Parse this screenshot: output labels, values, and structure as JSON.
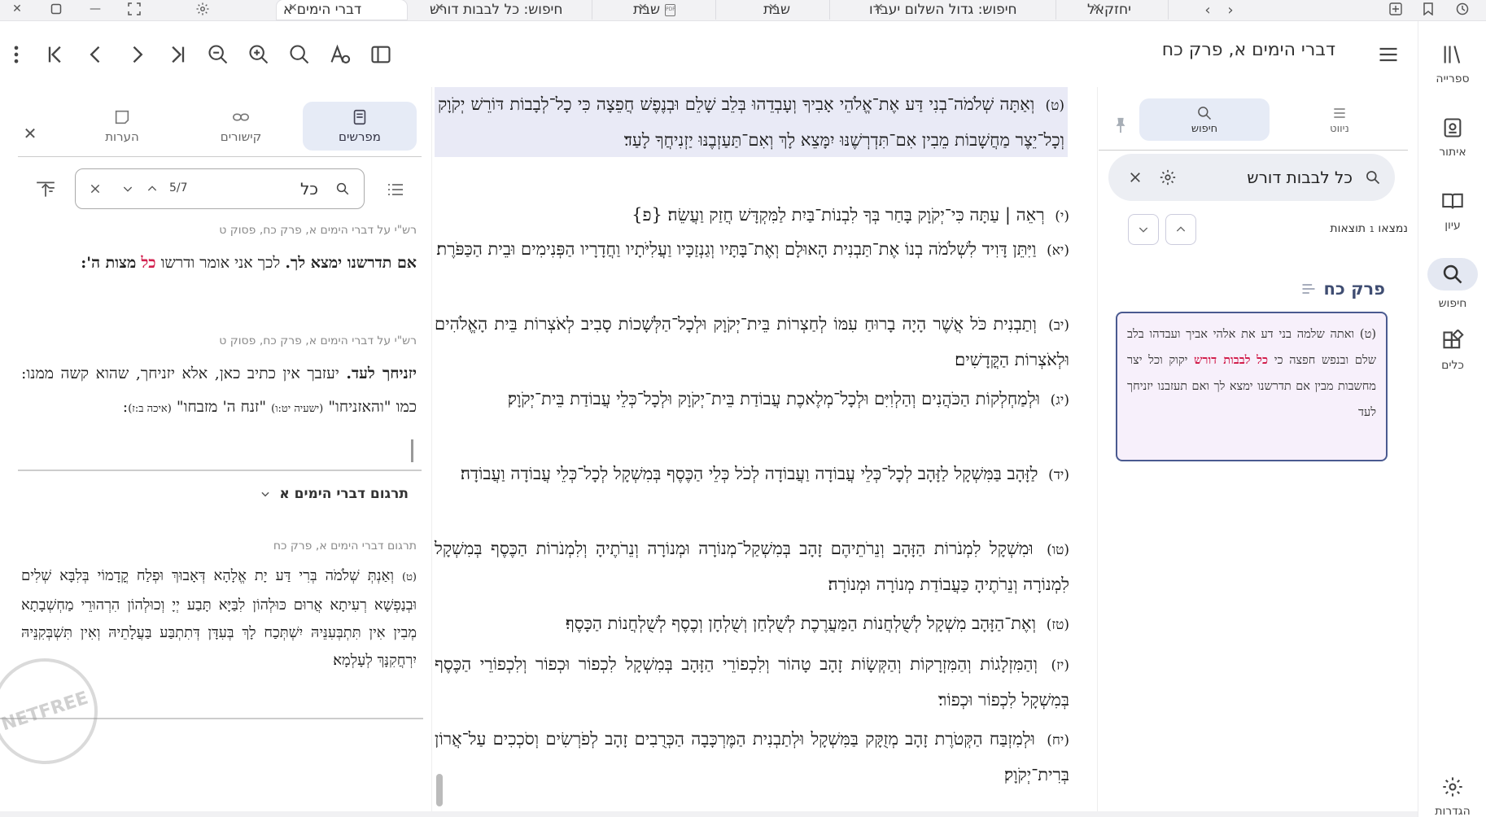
{
  "tabs": [
    {
      "label": "דברי הימים א",
      "active": true
    },
    {
      "label": "חיפוש: כל לבבות דורש",
      "active": false
    },
    {
      "label": "שבת",
      "active": false,
      "icon": "pdf-icon"
    },
    {
      "label": "שבת",
      "active": false
    },
    {
      "label": "חיפוש: גדול השלום יעבדו",
      "active": false
    },
    {
      "label": "יחזקאל",
      "active": false
    }
  ],
  "toolbar": {
    "title": "דברי הימים א, פרק כח"
  },
  "rail": [
    {
      "label": "ספרייה",
      "icon": "library-icon"
    },
    {
      "label": "איתור",
      "icon": "locate-icon"
    },
    {
      "label": "עיון",
      "icon": "book-icon"
    },
    {
      "label": "חיפוש",
      "icon": "search-icon",
      "active": true
    },
    {
      "label": "כלים",
      "icon": "tools-icon"
    },
    {
      "label": "הגדרות",
      "icon": "gear-icon"
    }
  ],
  "search_panel": {
    "tabs": {
      "nav": "ניווט",
      "search": "חיפוש"
    },
    "query": "כל לבבות דורש",
    "count_prefix": "נמצאו",
    "count_num": "1",
    "count_suffix": "תוצאות",
    "chapter": "פרק כח",
    "result": {
      "before": "(ט) ואתה שלמה בני דע את אלהי אביך ועבדהו בלב שלם ובנפש חפצה כי",
      "hl1": "כל",
      "hl2": "לבבות דורש",
      "after": "יקוק וכל יצר מחשבות מבין אם תדרשנו ימצא לך ואם תעזבנו יזניחך לעד"
    }
  },
  "main": {
    "verses": [
      {
        "num": "(ט)",
        "text": "וְאַתָּה שְׁלֹמֹה־בְנִי דַּע אֶת־אֱלֹהֵי אָבִיךָ וְעָבְדֵהוּ בְּלֵב שָׁלֵם וּבְנֶפֶשׁ חֲפֵצָה כִּי כָל־לְבָבוֹת דּוֹרֵשׁ יְקֹוָק וְכָל־יֵצֶר מַחֲשָׁבוֹת מֵבִין אִם־תִּדְרְשֶׁנּוּ יִמָּצֵא לָךְ וְאִם־תַּעַזְבֶנּוּ יַזְנִיחֲךָ לָעַד׃"
      },
      {
        "num": "(י)",
        "text": "רְאֵה | עַתָּה כִּי־יְקֹוָק בָּחַר בְּךָ לִבְנוֹת־בַּיִת לַמִּקְדָּשׁ חֲזַק וַעֲשֵׂה׃ {פ}"
      },
      {
        "num": "(יא)",
        "text": "וַיִּתֵּן דָּוִיד לִשְׁלֹמֹה בְנוֹ אֶת־תַּבְנִית הָאוּלָם וְאֶת־בָּתָּיו וְגַנְזַכָּיו וַעֲלִיֹּתָיו וַחֲדָרָיו הַפְּנִימִים וּבֵית הַכַּפֹּרֶת׃"
      },
      {
        "num": "(יב)",
        "text": "וְתַבְנִית כֹּל אֲשֶׁר הָיָה בָרוּחַ עִמּוֹ לְחַצְרוֹת בֵּית־יְקֹוָק וּלְכָל־הַלְּשָׁכוֹת סָבִיב לְאֹצְרוֹת בֵּית הָאֱלֹהִים וּלְאֹצְרוֹת הַקֳּדָשִׁים׃"
      },
      {
        "num": "(יג)",
        "text": "וּלְמַחְלְקוֹת הַכֹּהֲנִים וְהַלְוִיִּם וּלְכָל־מְלֶאכֶת עֲבוֹדַת בֵּית־יְקֹוָק וּלְכָל־כְּלֵי עֲבוֹדַת בֵּית־יְקֹוָק׃"
      },
      {
        "num": "(יד)",
        "text": "לַזָּהָב בַּמִּשְׁקָל לַזָּהָב לְכָל־כְּלֵי עֲבוֹדָה וַעֲבוֹדָה לְכֹל כְּלֵי הַכֶּסֶף בְּמִשְׁקָל לְכָל־כְּלֵי עֲבוֹדָה וַעֲבוֹדָה׃"
      },
      {
        "num": "(טו)",
        "text": "וּמִשְׁקָל לִמְנֹרוֹת הַזָּהָב וְנֵרֹתֵיהֶם זָהָב בְּמִשְׁקַל־מְנוֹרָה וּמְנוֹרָה וְנֵרֹתֶיהָ וְלִמְנֹרוֹת הַכֶּסֶף בְּמִשְׁקָל לִמְנוֹרָה וְנֵרֹתֶיהָ כַּעֲבוֹדַת מְנוֹרָה וּמְנוֹרָה׃"
      },
      {
        "num": "(טז)",
        "text": "וְאֶת־הַזָּהָב מִשְׁקָל לְשֻׁלְחֲנוֹת הַמַּעֲרֶכֶת לְשֻׁלְחַן וְשֻׁלְחָן וְכֶסֶף לְשֻׁלְחֲנוֹת הַכָּסֶף׃"
      },
      {
        "num": "(יז)",
        "text": "וְהַמִּזְלָגוֹת וְהַמִּזְרָקוֹת וְהַקְּשָׂוֹת זָהָב טָהוֹר וְלִכְפוֹרֵי הַזָּהָב בְּמִשְׁקָל לִכְפוֹר וּכְפוֹר וְלִכְפוֹרֵי הַכֶּסֶף בְּמִשְׁקָל לִכְפוֹר וּכְפוֹר׃"
      },
      {
        "num": "(יח)",
        "text": "וּלְמִזְבַּח הַקְּטֹרֶת זָהָב מְזֻקָּק בַּמִּשְׁקָל וּלְתַבְנִית הַמֶּרְכָּבָה הַכְּרֻבִים זָהָב לְפֹרְשִׂים וְסֹכְכִים עַל־אֲרוֹן בְּרִית־יְקֹוָק׃"
      }
    ]
  },
  "commentary": {
    "tabs": {
      "commentators": "מפרשים",
      "links": "קישורים",
      "notes": "הערות"
    },
    "find_value": "כל",
    "find_count": "5/7",
    "items": [
      {
        "source": "רש\"י על דברי הימים א, פרק כח, פסוק ט",
        "head": "אם תדרשנו ימצא לך.",
        "text_pre": "לכך אני אומר ודרשו",
        "red": "כל",
        "text_post": "מצות ה':"
      },
      {
        "source": "רש\"י על דברי הימים א, פרק כח, פסוק ט",
        "head": "יזניחך לעד.",
        "text": "יעזבך אין כתיב כאן, אלא יזניחך, שהוא קשה ממנו: כמו \"והאזניחו\"",
        "ref1": "(ישעיה יט:ו)",
        "text2": "\"זנח ה' מזבחו\"",
        "ref2": "(איכה ב:ז)",
        "end": ":"
      }
    ],
    "targum": {
      "header": "תרגום דברי הימים א",
      "source": "תרגום דברי הימים א, פרק כח",
      "num": "(ט)",
      "text": "וְאַנְתְּ שְׁלֹמֹה בְּרִי דַּע יָת אֱלָהָא דְּאָבוּךְ וּפְלַח קֳדָמוֹי בְּלִבָּא שְׁלִים וּבְנַפְשָׁא רְעִיתָא אֲרוּם כּוּלְהוֹן לִבַּיָּא תָּבַע יְיָ וְכוּלְהוֹן הִרְהוּרֵי מַחְשְׁבָתָא מְבִין אִין תִּתְבְּעִנֵּיהּ יִשְׁתְּכַח לָךְ בְּעִדָּן דְּתִתְבַּע בַּעֲלָתֵיהּ וְאִין תִּשְׁבְּקִנֵּיהּ יִרְחֲקִנָּךְ לְעָלְמָא׃"
    }
  },
  "watermark": "NETFREE"
}
